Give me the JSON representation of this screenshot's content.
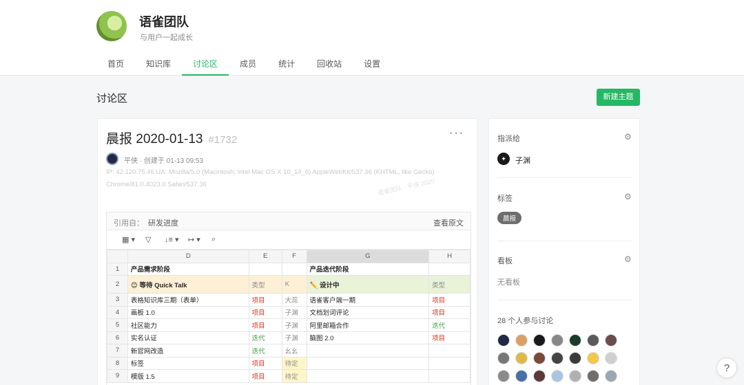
{
  "team": {
    "name": "语雀团队",
    "subtitle": "与用户一起成长"
  },
  "nav": {
    "items": [
      "首页",
      "知识库",
      "讨论区",
      "成员",
      "统计",
      "回收站",
      "设置"
    ],
    "active": "讨论区"
  },
  "section": {
    "title": "讨论区",
    "new_topic_label": "新建主题"
  },
  "post": {
    "title": "晨报 2020-01-13",
    "number": "#1732",
    "more_label": "···",
    "author_line": "平侠 · 创建于 01-13 09:53",
    "meta_line_1": "IP: 42.120.75.46    UA: Mozilla/5.0 (Macintosh; Intel Mac OS X 10_14_6) AppleWebKit/537.36 (KHTML, like Gecko)",
    "meta_line_2": "Chrome/81.0.4023.0 Safari/537.36",
    "watermark": "语雀团队 · 平侠 2020"
  },
  "quote": {
    "from_label": "引用自：",
    "from_value": "研发进度",
    "view_original": "查看原文"
  },
  "sheet": {
    "columns": [
      "D",
      "E",
      "F",
      "G",
      "H"
    ],
    "rows": [
      {
        "n": "1",
        "d": "产品需求阶段",
        "e": "",
        "f": "",
        "g": "产品迭代阶段",
        "h": ""
      },
      {
        "n": "2",
        "d": "😊 等待 Quick Talk",
        "e": "类型",
        "f": "K",
        "g": "✏️ 设计中",
        "h": "类型"
      },
      {
        "n": "3",
        "d": "表格知识库三期（表单）",
        "e": "项目",
        "f": "大蕊",
        "g": "语雀客户端一期",
        "h": "项目"
      },
      {
        "n": "4",
        "d": "画板 1.0",
        "e": "项目",
        "f": "子渊",
        "g": "文档划词评论",
        "h": "项目"
      },
      {
        "n": "5",
        "d": "社区能力",
        "e": "项目",
        "f": "子渊",
        "g": "阿里邮箱合作",
        "h": "迭代"
      },
      {
        "n": "6",
        "d": "实名认证",
        "e": "迭代",
        "f": "子渊",
        "g": "脑图 2.0",
        "h": "项目"
      },
      {
        "n": "7",
        "d": "新官网改造",
        "e": "迭代",
        "f": "幺幺",
        "g": "",
        "h": ""
      },
      {
        "n": "8",
        "d": "标签",
        "e": "项目",
        "f": "待定",
        "g": "",
        "h": ""
      },
      {
        "n": "9",
        "d": "模版 1.5",
        "e": "项目",
        "f": "待定",
        "g": "",
        "h": ""
      }
    ]
  },
  "sidebar": {
    "assign_label": "指派给",
    "assignee": "子渊",
    "tags_label": "标签",
    "tag": "晨报",
    "board_label": "看板",
    "no_board": "无看板",
    "participants_label": "28 个人参与讨论"
  },
  "help_label": "?"
}
